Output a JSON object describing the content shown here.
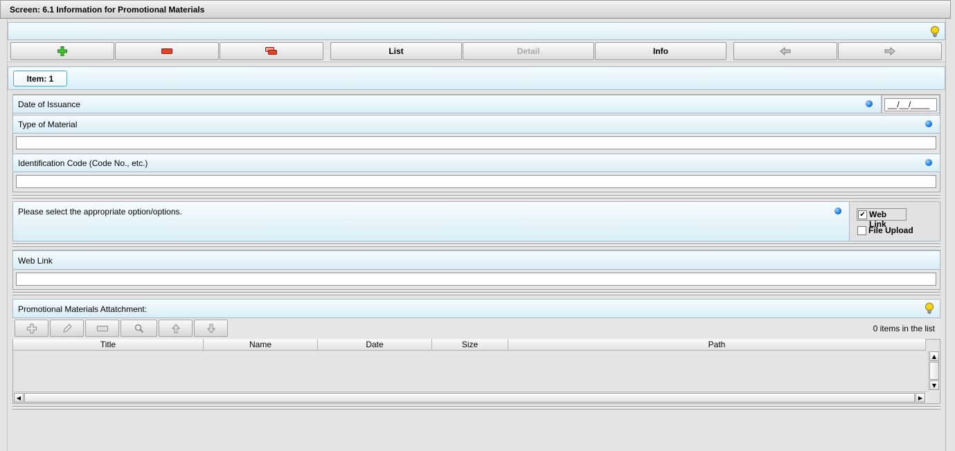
{
  "window": {
    "title": "Screen: 6.1 Information for Promotional Materials"
  },
  "toolbar": {
    "list_label": "List",
    "detail_label": "Detail",
    "info_label": "Info"
  },
  "item_tab": {
    "label": "Item: 1"
  },
  "form": {
    "date_of_issuance": {
      "label": "Date of Issuance",
      "value": "__/__/____"
    },
    "type_of_material": {
      "label": "Type of Material",
      "value": ""
    },
    "identification_code": {
      "label": "Identification Code (Code No., etc.)",
      "value": ""
    },
    "options": {
      "prompt": "Please select the appropriate option/options.",
      "web_link": {
        "label": "Web Link",
        "checked": true
      },
      "file_upload": {
        "label": "File Upload",
        "checked": false
      }
    },
    "web_link_field": {
      "label": "Web Link",
      "value": ""
    }
  },
  "attachments": {
    "title": "Promotional Materials Attatchment:",
    "count_text": "0 items in the list",
    "columns": [
      "Title",
      "Name",
      "Date",
      "Size",
      "Path"
    ],
    "rows": []
  },
  "icons": {
    "add": "add-icon",
    "remove": "remove-icon",
    "copy": "copy-icon",
    "prev": "arrow-left-icon",
    "next": "arrow-right-icon",
    "hint": "lightbulb-icon",
    "required": "required-dot-icon"
  },
  "colors": {
    "band_top": "#f6fcff",
    "band_bottom": "#d9eef7",
    "required_dot": "#1a73d9",
    "add_icon": "#3cbb2f",
    "remove_icon": "#d9432b",
    "hint_bulb": "#e8c21a"
  }
}
